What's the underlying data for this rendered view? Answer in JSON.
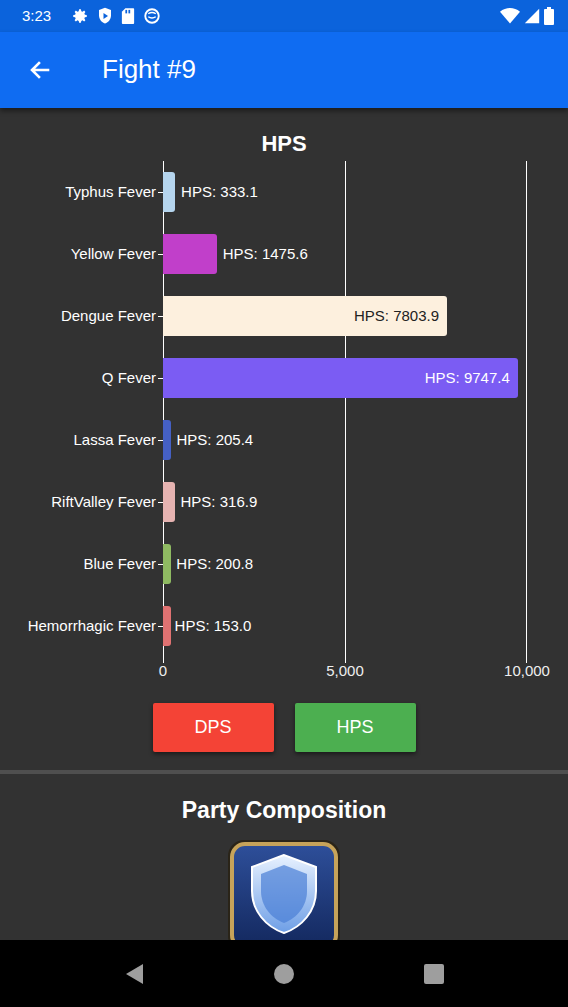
{
  "status_bar": {
    "time": "3:23"
  },
  "app_bar": {
    "title": "Fight #9"
  },
  "chart": {
    "title": "HPS",
    "axis_max": 10000,
    "ticks": [
      "0",
      "5,000",
      "10,000"
    ],
    "series": [
      {
        "name": "HPS",
        "values": [
          333.1,
          1475.6,
          7803.9,
          9747.4,
          205.4,
          316.9,
          200.8,
          153.0
        ]
      }
    ],
    "bars": [
      {
        "category": "Typhus Fever",
        "label": "HPS: 333.1",
        "color": "#b5d5ee"
      },
      {
        "category": "Yellow Fever",
        "label": "HPS: 1475.6",
        "color": "#c13fca"
      },
      {
        "category": "Dengue Fever",
        "label": "HPS: 7803.9",
        "color": "#fdf0de"
      },
      {
        "category": "Q Fever",
        "label": "HPS: 9747.4",
        "color": "#7b5cf3"
      },
      {
        "category": "Lassa Fever",
        "label": "HPS: 205.4",
        "color": "#4560c4"
      },
      {
        "category": "RiftValley Fever",
        "label": "HPS: 316.9",
        "color": "#e6b3b1"
      },
      {
        "category": "Blue Fever",
        "label": "HPS: 200.8",
        "color": "#8fba62"
      },
      {
        "category": "Hemorrhagic Fever",
        "label": "HPS: 153.0",
        "color": "#e07272"
      }
    ]
  },
  "buttons": [
    {
      "label": "DPS",
      "color": "#f44336"
    },
    {
      "label": "HPS",
      "color": "#4caf50"
    }
  ],
  "party": {
    "title": "Party Composition"
  }
}
